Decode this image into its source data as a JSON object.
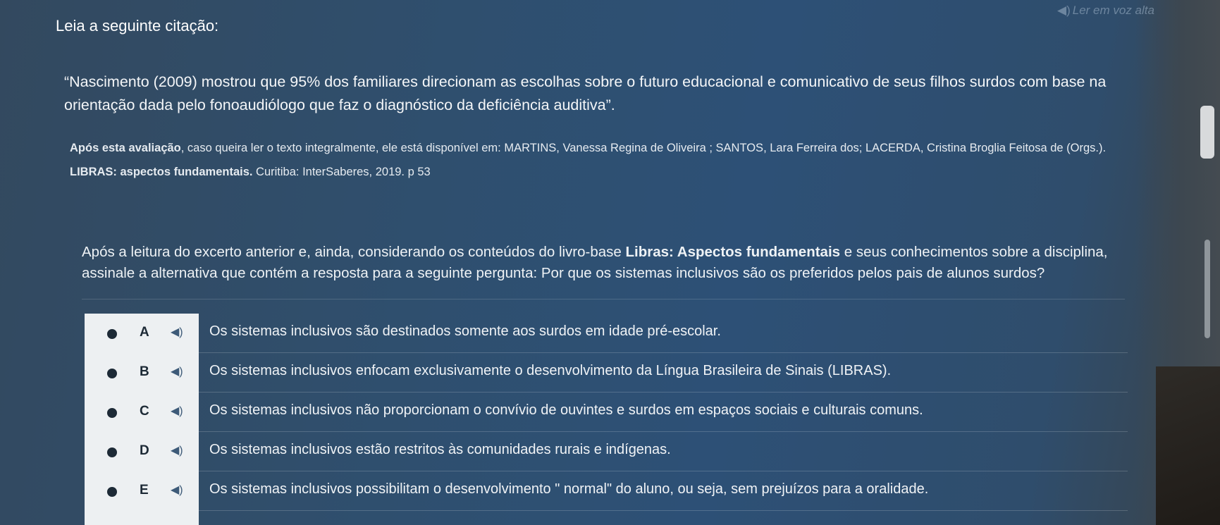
{
  "read_aloud": {
    "label": "Ler em voz alta",
    "icon": "speaker-icon"
  },
  "intro_title": "Leia a seguinte citação:",
  "quote": "“Nascimento (2009) mostrou que 95% dos familiares direcionam as escolhas sobre o futuro educacional e comunicativo de seus filhos surdos com base na orientação dada pelo fonoaudiólogo que faz o diagnóstico da deficiência auditiva”.",
  "reference": {
    "lead_bold": "Após esta avaliação",
    "text": ", caso queira ler o texto integralmente, ele está disponível em: MARTINS, Vanessa Regina de Oliveira ; SANTOS, Lara Ferreira dos; LACERDA, Cristina Broglia Feitosa de (Orgs.).",
    "book_bold": "LIBRAS: aspectos fundamentais.",
    "tail": " Curitiba: InterSaberes, 2019. p 53"
  },
  "question": {
    "part1": "Após a leitura do excerto anterior e, ainda, considerando os conteúdos do livro-base ",
    "bold": "Libras: Aspectos fundamentais",
    "part2": " e seus conhecimentos sobre a disciplina, assinale a alternativa que contém a resposta para a seguinte pergunta: Por que os sistemas inclusivos são os preferidos pelos pais de alunos surdos?"
  },
  "options": [
    {
      "letter": "A",
      "text": "Os sistemas inclusivos são destinados somente aos surdos em idade pré-escolar."
    },
    {
      "letter": "B",
      "text": "Os sistemas inclusivos enfocam exclusivamente o desenvolvimento da Língua Brasileira de Sinais (LIBRAS)."
    },
    {
      "letter": "C",
      "text": "Os sistemas inclusivos não proporcionam o convívio de ouvintes e surdos em espaços sociais e culturais comuns."
    },
    {
      "letter": "D",
      "text": "Os sistemas inclusivos estão restritos às comunidades rurais e indígenas."
    },
    {
      "letter": "E",
      "text": "Os sistemas inclusivos possibilitam o desenvolvimento \" normal\" do aluno, ou seja, sem prejuízos para a oralidade."
    }
  ],
  "colors": {
    "background": "#2f4f6e",
    "option_panel": "#edf0f2",
    "text": "#ffffff"
  }
}
